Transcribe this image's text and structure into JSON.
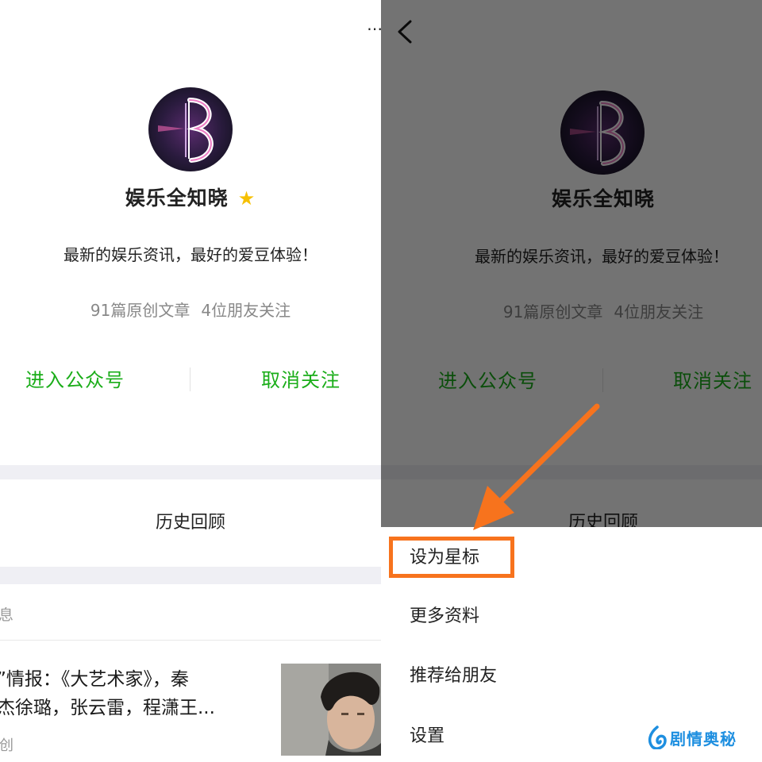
{
  "profile": {
    "name": "娱乐全知晓",
    "intro": "最新的娱乐资讯，最好的爱豆体验！",
    "articles_count": "91篇原创文章",
    "friends_following": "4位朋友关注",
    "enter_account_label": "进入公众号",
    "unfollow_label": "取消关注",
    "history_label": "历史回顾"
  },
  "messages": {
    "header_partial": "消息",
    "article_title_line1": "星”情报：《大艺术家》，秦",
    "article_title_line2": "俊杰徐璐，张云雷，程潇王...",
    "article_tag_partial": "原创"
  },
  "menu": {
    "items": [
      {
        "label": "设为星标",
        "highlighted": true
      },
      {
        "label": "更多资料",
        "highlighted": false
      },
      {
        "label": "推荐给朋友",
        "highlighted": false
      },
      {
        "label": "设置",
        "highlighted": false
      }
    ]
  },
  "icons": {
    "top_left_pane": "more-dots-icon",
    "top_right_pane": "back-chevron-icon",
    "star": "star-icon",
    "avatar_logo": "avatar-logo"
  },
  "watermark": {
    "text": "剧情奥秘"
  },
  "colors": {
    "accent_green": "#1aad19",
    "highlight_orange": "#f7731d",
    "star_yellow": "#f6c000",
    "watermark_blue": "#1e8fe0",
    "overlay": "rgba(0,0,0,0.55)"
  }
}
